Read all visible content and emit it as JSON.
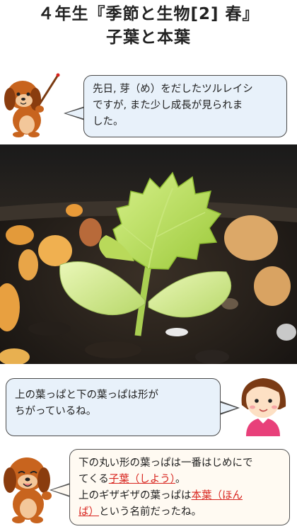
{
  "title": {
    "line1": "４年生『季節と生物[2] 春』",
    "line2": "子葉と本葉"
  },
  "bubble1": {
    "line1": "先日, 芽（め）をだしたツルレイシ",
    "line2": "ですが, また少し成長が見られま",
    "line3": "した。"
  },
  "bubble2": {
    "line1": "上の葉っぱと下の葉っぱは形が",
    "line2": "ちがっているね。"
  },
  "bubble3": {
    "line1": "下の丸い形の葉っぱは一番はじめにで",
    "line2_pre": "てくる",
    "line2_term": "子葉（しよう）",
    "line2_post": "。",
    "line3_pre": "上のギザギザの葉っぱは",
    "line3_term": "本葉（ほん",
    "line4_term": "ば）",
    "line4_post": "という名前だったね。"
  },
  "colors": {
    "highlight": "#d8241e",
    "bubble_fill": "#e8f1fa",
    "dog": "#c8641e",
    "girl_shirt": "#e8407a"
  }
}
